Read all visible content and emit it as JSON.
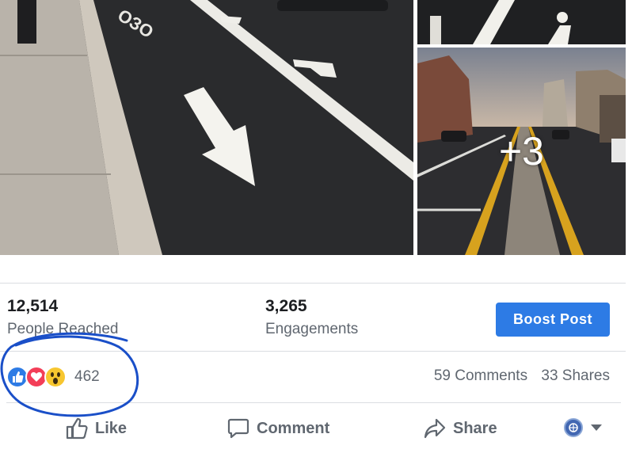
{
  "photos": {
    "more_count_label": "+3"
  },
  "insights": {
    "people_reached_value": "12,514",
    "people_reached_label": "People Reached",
    "engagements_value": "3,265",
    "engagements_label": "Engagements",
    "boost_label": "Boost Post"
  },
  "reactions": {
    "types": [
      "like-icon",
      "love-icon",
      "wow-icon"
    ],
    "total": "462",
    "comments": "59 Comments",
    "shares": "33 Shares"
  },
  "actions": {
    "like": "Like",
    "comment": "Comment",
    "share": "Share"
  },
  "colors": {
    "accent": "#2d7be5",
    "annotation": "#1a4fc8",
    "love": "#f33e58",
    "wow": "#f7c62f"
  }
}
